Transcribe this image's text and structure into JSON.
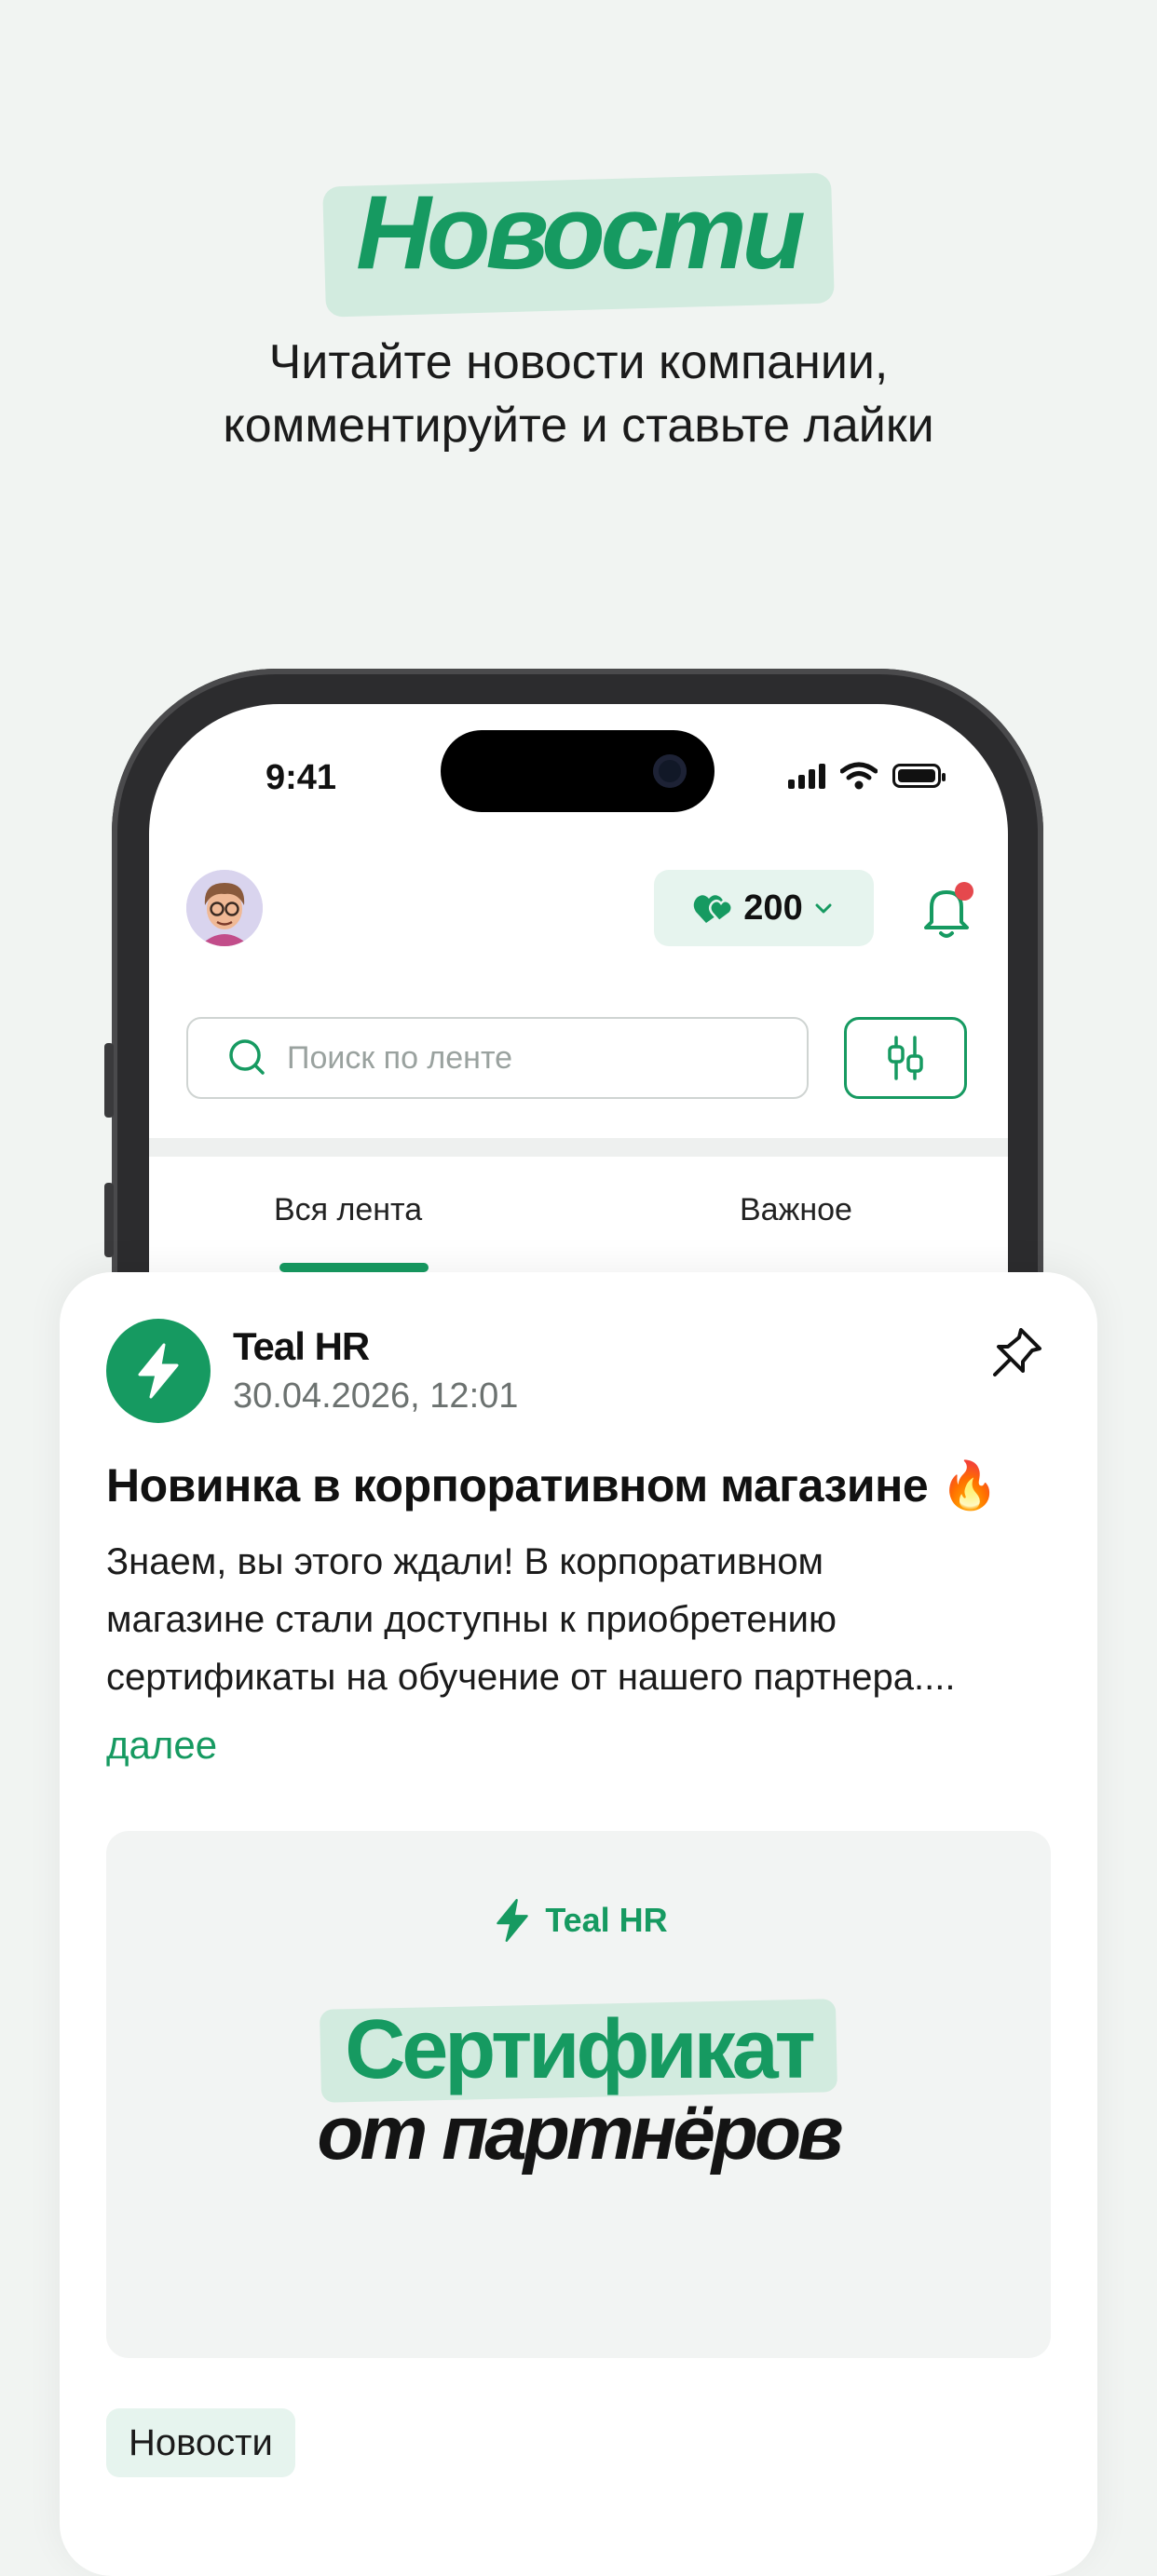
{
  "hero": {
    "title": "Новости",
    "subtitle_line1": "Читайте новости компании,",
    "subtitle_line2": "комментируйте и ставьте лайки"
  },
  "status_bar": {
    "time": "9:41"
  },
  "header": {
    "coins": "200"
  },
  "search": {
    "placeholder": "Поиск по ленте"
  },
  "tabs": [
    {
      "label": "Вся лента",
      "active": true
    },
    {
      "label": "Важное",
      "active": false
    }
  ],
  "post": {
    "author": "Teal HR",
    "date": "30.04.2026, 12:01",
    "title": "Новинка в корпоративном магазине 🔥",
    "body_lines": [
      "Знаем, вы этого ждали! В корпоративном",
      "магазине стали доступны к приобретению",
      "сертификаты на обучение от нашего партнера...."
    ],
    "more": "далее",
    "banner": {
      "brand": "Teal HR",
      "headline": "Сертификат",
      "subheadline": "от партнёров"
    },
    "tag": "Новости"
  },
  "colors": {
    "accent": "#169a61",
    "accent_soft": "#d2ebdf",
    "background": "#f1f4f2"
  }
}
